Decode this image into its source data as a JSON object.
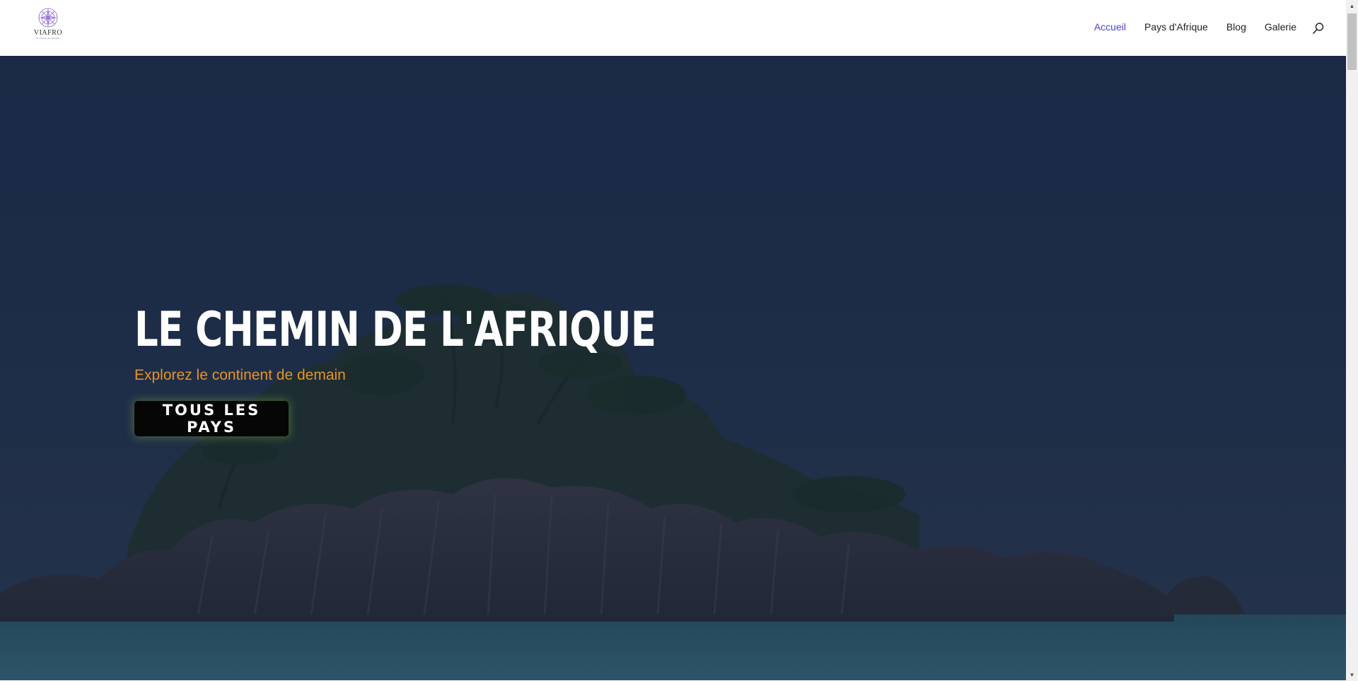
{
  "header": {
    "logo": {
      "name": "VIAFRO",
      "tagline": "le chemin de l'afrique"
    },
    "nav": [
      {
        "label": "Accueil",
        "active": true
      },
      {
        "label": "Pays d'Afrique",
        "active": false
      },
      {
        "label": "Blog",
        "active": false
      },
      {
        "label": "Galerie",
        "active": false
      }
    ],
    "search_icon": "search-icon"
  },
  "hero": {
    "title": "LE CHEMIN DE L'AFRIQUE",
    "subtitle": "Explorez le continent de demain",
    "button_label": "TOUS LES PAYS"
  },
  "colors": {
    "nav_active": "#4c3fe0",
    "subtitle": "#e8941f",
    "button_bg": "#060606",
    "hero_overlay": "#1e2f4c"
  }
}
